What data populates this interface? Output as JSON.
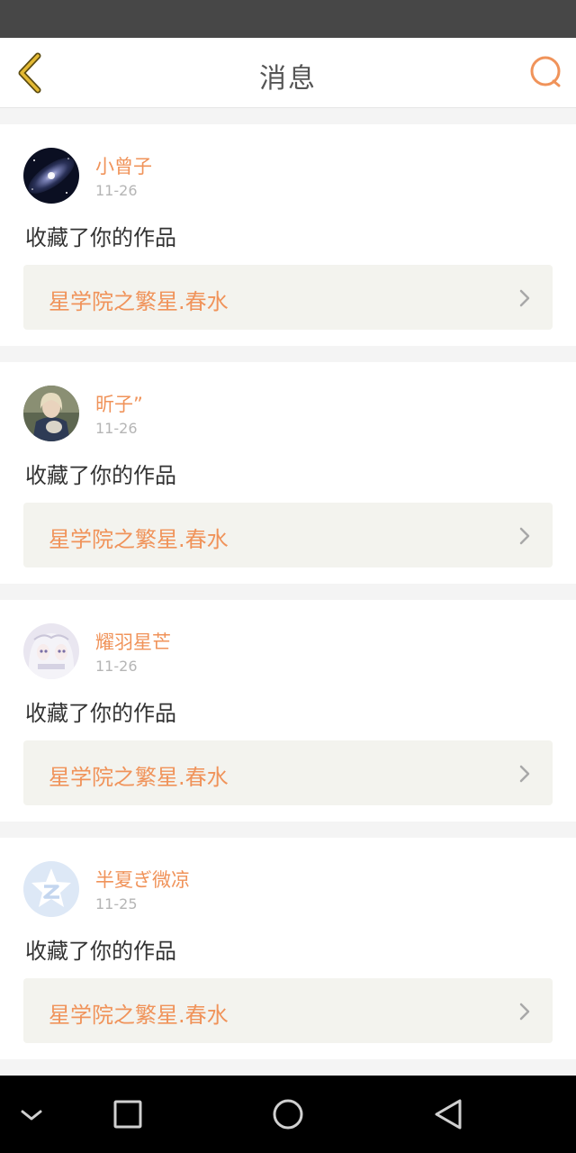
{
  "header": {
    "title": "消息"
  },
  "icons": {
    "back": "chevron-left-icon",
    "search": "search-icon",
    "item_arrow": "chevron-right-icon",
    "nav_down": "chevron-down-icon",
    "nav_recent": "square-icon",
    "nav_home": "circle-icon",
    "nav_back": "triangle-back-icon"
  },
  "colors": {
    "accent": "#f0935a",
    "back_icon": "#c9a22a",
    "status_bar": "#474747"
  },
  "messages": [
    {
      "user": "小曾子",
      "date": "11-26",
      "action": "收藏了你的作品",
      "work": "星学院之繁星.春水",
      "avatar": "galaxy-avatar"
    },
    {
      "user": "昕子”",
      "date": "11-26",
      "action": "收藏了你的作品",
      "work": "星学院之繁星.春水",
      "avatar": "photo-avatar"
    },
    {
      "user": "耀羽星芒",
      "date": "11-26",
      "action": "收藏了你的作品",
      "work": "星学院之繁星.春水",
      "avatar": "anime-avatar"
    },
    {
      "user": "半夏ぎ微凉",
      "date": "11-25",
      "action": "收藏了你的作品",
      "work": "星学院之繁星.春水",
      "avatar": "qzone-default-avatar"
    }
  ]
}
